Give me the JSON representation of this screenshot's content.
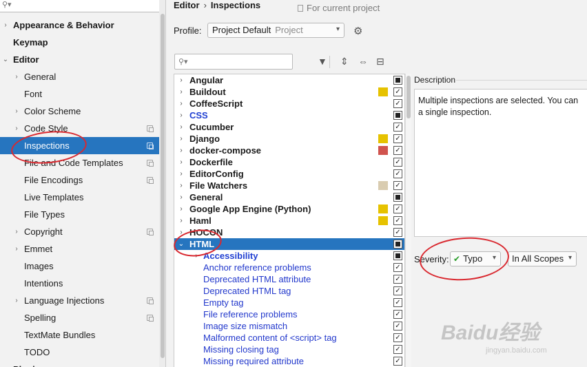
{
  "sidebar": {
    "search_placeholder": "",
    "items": [
      {
        "label": "Appearance & Behavior",
        "indent": 0,
        "arrow": "›",
        "bold": true,
        "copy": false,
        "selected": false
      },
      {
        "label": "Keymap",
        "indent": 0,
        "arrow": "",
        "bold": true,
        "copy": false,
        "selected": false
      },
      {
        "label": "Editor",
        "indent": 0,
        "arrow": "⌄",
        "bold": true,
        "copy": false,
        "selected": false
      },
      {
        "label": "General",
        "indent": 1,
        "arrow": "›",
        "bold": false,
        "copy": false,
        "selected": false
      },
      {
        "label": "Font",
        "indent": 1,
        "arrow": "",
        "bold": false,
        "copy": false,
        "selected": false
      },
      {
        "label": "Color Scheme",
        "indent": 1,
        "arrow": "›",
        "bold": false,
        "copy": false,
        "selected": false
      },
      {
        "label": "Code Style",
        "indent": 1,
        "arrow": "›",
        "bold": false,
        "copy": true,
        "selected": false
      },
      {
        "label": "Inspections",
        "indent": 1,
        "arrow": "",
        "bold": false,
        "copy": true,
        "selected": true
      },
      {
        "label": "File and Code Templates",
        "indent": 1,
        "arrow": "",
        "bold": false,
        "copy": true,
        "selected": false
      },
      {
        "label": "File Encodings",
        "indent": 1,
        "arrow": "",
        "bold": false,
        "copy": true,
        "selected": false
      },
      {
        "label": "Live Templates",
        "indent": 1,
        "arrow": "",
        "bold": false,
        "copy": false,
        "selected": false
      },
      {
        "label": "File Types",
        "indent": 1,
        "arrow": "",
        "bold": false,
        "copy": false,
        "selected": false
      },
      {
        "label": "Copyright",
        "indent": 1,
        "arrow": "›",
        "bold": false,
        "copy": true,
        "selected": false
      },
      {
        "label": "Emmet",
        "indent": 1,
        "arrow": "›",
        "bold": false,
        "copy": false,
        "selected": false
      },
      {
        "label": "Images",
        "indent": 1,
        "arrow": "",
        "bold": false,
        "copy": false,
        "selected": false
      },
      {
        "label": "Intentions",
        "indent": 1,
        "arrow": "",
        "bold": false,
        "copy": false,
        "selected": false
      },
      {
        "label": "Language Injections",
        "indent": 1,
        "arrow": "›",
        "bold": false,
        "copy": true,
        "selected": false
      },
      {
        "label": "Spelling",
        "indent": 1,
        "arrow": "",
        "bold": false,
        "copy": true,
        "selected": false
      },
      {
        "label": "TextMate Bundles",
        "indent": 1,
        "arrow": "",
        "bold": false,
        "copy": false,
        "selected": false
      },
      {
        "label": "TODO",
        "indent": 1,
        "arrow": "",
        "bold": false,
        "copy": false,
        "selected": false
      },
      {
        "label": "Plugins",
        "indent": 0,
        "arrow": "",
        "bold": true,
        "copy": false,
        "selected": false
      }
    ]
  },
  "breadcrumb": {
    "parent": "Editor",
    "separator": "›",
    "current": "Inspections"
  },
  "scope_note": "For current project",
  "profile": {
    "label": "Profile:",
    "value": "Project Default",
    "hint": "Project"
  },
  "list": {
    "rows": [
      {
        "label": "Angular",
        "type": "group",
        "arrow": "›",
        "swatch": "",
        "check": "mixed",
        "indent": 0
      },
      {
        "label": "Buildout",
        "type": "group",
        "arrow": "›",
        "swatch": "#e6c200",
        "check": "checked",
        "indent": 0
      },
      {
        "label": "CoffeeScript",
        "type": "group",
        "arrow": "›",
        "swatch": "",
        "check": "checked",
        "indent": 0
      },
      {
        "label": "CSS",
        "type": "group-blue",
        "arrow": "›",
        "swatch": "",
        "check": "mixed",
        "indent": 0
      },
      {
        "label": "Cucumber",
        "type": "group",
        "arrow": "›",
        "swatch": "",
        "check": "checked",
        "indent": 0
      },
      {
        "label": "Django",
        "type": "group",
        "arrow": "›",
        "swatch": "#e6c200",
        "check": "checked",
        "indent": 0
      },
      {
        "label": "docker-compose",
        "type": "group",
        "arrow": "›",
        "swatch": "#d0534e",
        "check": "checked",
        "indent": 0
      },
      {
        "label": "Dockerfile",
        "type": "group",
        "arrow": "›",
        "swatch": "",
        "check": "checked",
        "indent": 0
      },
      {
        "label": "EditorConfig",
        "type": "group",
        "arrow": "›",
        "swatch": "",
        "check": "checked",
        "indent": 0
      },
      {
        "label": "File Watchers",
        "type": "group",
        "arrow": "›",
        "swatch": "#d9ccb0",
        "check": "checked",
        "indent": 0
      },
      {
        "label": "General",
        "type": "group",
        "arrow": "›",
        "swatch": "",
        "check": "mixed",
        "indent": 0
      },
      {
        "label": "Google App Engine (Python)",
        "type": "group",
        "arrow": "›",
        "swatch": "#e6c200",
        "check": "checked",
        "indent": 0
      },
      {
        "label": "Haml",
        "type": "group",
        "arrow": "›",
        "swatch": "#e6c200",
        "check": "checked",
        "indent": 0
      },
      {
        "label": "HOCON",
        "type": "group",
        "arrow": "›",
        "swatch": "",
        "check": "checked",
        "indent": 0
      },
      {
        "label": "HTML",
        "type": "group-selected",
        "arrow": "⌄",
        "swatch": "",
        "check": "mixed",
        "indent": 0
      },
      {
        "label": "Accessibility",
        "type": "group-blue",
        "arrow": "›",
        "swatch": "",
        "check": "mixed",
        "indent": 1
      },
      {
        "label": "Anchor reference problems",
        "type": "link",
        "arrow": "",
        "swatch": "",
        "check": "checked",
        "indent": 1
      },
      {
        "label": "Deprecated HTML attribute",
        "type": "link",
        "arrow": "",
        "swatch": "",
        "check": "checked",
        "indent": 1
      },
      {
        "label": "Deprecated HTML tag",
        "type": "link",
        "arrow": "",
        "swatch": "",
        "check": "checked",
        "indent": 1
      },
      {
        "label": "Empty tag",
        "type": "link",
        "arrow": "",
        "swatch": "",
        "check": "checked",
        "indent": 1
      },
      {
        "label": "File reference problems",
        "type": "link",
        "arrow": "",
        "swatch": "",
        "check": "checked",
        "indent": 1
      },
      {
        "label": "Image size mismatch",
        "type": "link",
        "arrow": "",
        "swatch": "",
        "check": "checked",
        "indent": 1
      },
      {
        "label": "Malformed content of <script> tag",
        "type": "link",
        "arrow": "",
        "swatch": "",
        "check": "checked",
        "indent": 1
      },
      {
        "label": "Missing closing tag",
        "type": "link",
        "arrow": "",
        "swatch": "",
        "check": "checked",
        "indent": 1
      },
      {
        "label": "Missing required attribute",
        "type": "link",
        "arrow": "",
        "swatch": "",
        "check": "checked",
        "indent": 1
      }
    ]
  },
  "description": {
    "label": "Description",
    "line1": "Multiple inspections are selected. You can",
    "line2": "a single inspection."
  },
  "severity": {
    "label": "Severity:",
    "value": "Typo",
    "check_glyph": "✔"
  },
  "scope": {
    "value": "In All Scopes"
  },
  "icons": {
    "dropdown": "▾",
    "search": "⚲▾",
    "gear": "⚙",
    "filter": "▼",
    "expand": "⇕",
    "collapse": "⇔",
    "minus": "⊟"
  },
  "watermark": {
    "text": "Baidu经验",
    "sub": "jingyan.baidu.com"
  },
  "accent": "#2675bf"
}
